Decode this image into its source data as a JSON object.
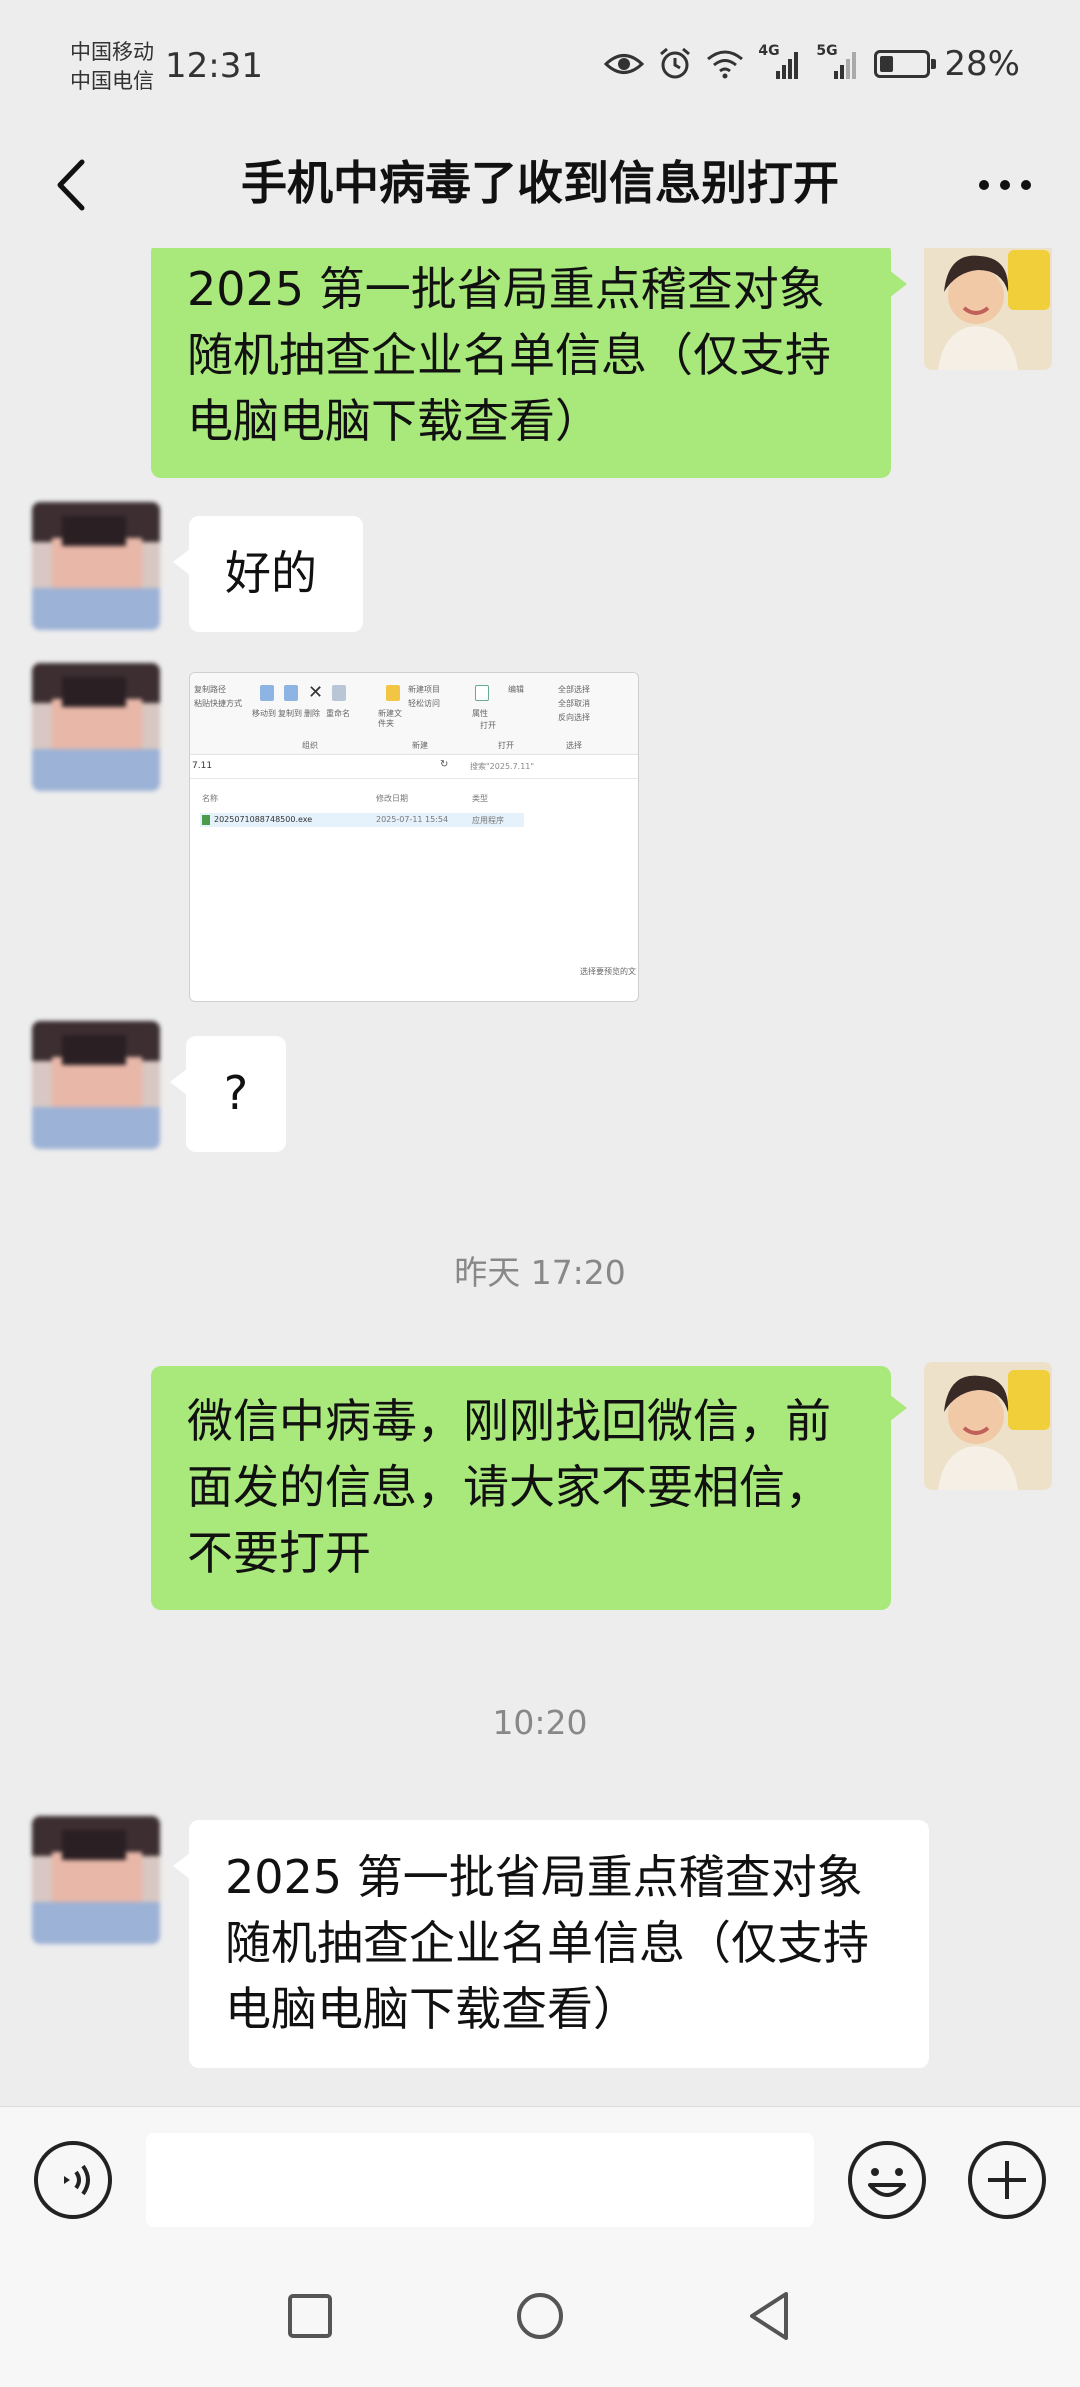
{
  "status_bar": {
    "carrier_1": "中国移动",
    "carrier_2": "中国电信",
    "time": "12:31",
    "network_1": "4G",
    "network_2": "5G",
    "battery_percent": "28%",
    "battery_level": 0.28,
    "icons": [
      "eye-icon",
      "alarm-icon",
      "wifi-icon",
      "signal-icon",
      "signal-icon",
      "battery-icon"
    ]
  },
  "header": {
    "title": "手机中病毒了收到信息别打开",
    "back_icon": "chevron-left-icon",
    "more_icon": "more-icon"
  },
  "messages": [
    {
      "sender": "self",
      "type": "text",
      "text": "2025 第一批省局重点稽查对象随机抽查企业名单信息（仅支持电脑电脑下载查看）"
    },
    {
      "sender": "contact",
      "type": "text",
      "text": "好的"
    },
    {
      "sender": "contact",
      "type": "image",
      "content": {
        "ribbon_left": [
          "复制路径",
          "粘贴快捷方式"
        ],
        "ribbon_buttons": [
          "移动到",
          "复制到",
          "删除",
          "重命名",
          "新建文件夹"
        ],
        "ribbon_new": [
          "新建项目",
          "轻松访问"
        ],
        "ribbon_open": [
          "属性",
          "打开",
          "编辑"
        ],
        "ribbon_select": [
          "全部选择",
          "全部取消",
          "反向选择"
        ],
        "groups": [
          "组织",
          "新建",
          "打开",
          "选择"
        ],
        "path": "7.11",
        "search": "搜索\"2025.7.11\"",
        "columns": [
          "名称",
          "修改日期",
          "类型"
        ],
        "file_name": "2025071088748500.exe",
        "file_date": "2025-07-11 15:54",
        "file_type": "应用程序",
        "hint": "选择要预览的文"
      }
    },
    {
      "sender": "contact",
      "type": "text",
      "text": "?"
    },
    {
      "type": "time",
      "text": "昨天 17:20"
    },
    {
      "sender": "self",
      "type": "text",
      "text": "微信中病毒，刚刚找回微信，前面发的信息，请大家不要相信，不要打开"
    },
    {
      "type": "time",
      "text": "10:20"
    },
    {
      "sender": "contact",
      "type": "text",
      "text": "2025 第一批省局重点稽查对象随机抽查企业名单信息（仅支持电脑电脑下载查看）"
    }
  ],
  "input_bar": {
    "voice_icon": "voice-icon",
    "text_value": "",
    "emoji_icon": "emoji-icon",
    "plus_icon": "plus-icon"
  },
  "system_nav": [
    "recent-apps-icon",
    "home-icon",
    "back-icon"
  ]
}
